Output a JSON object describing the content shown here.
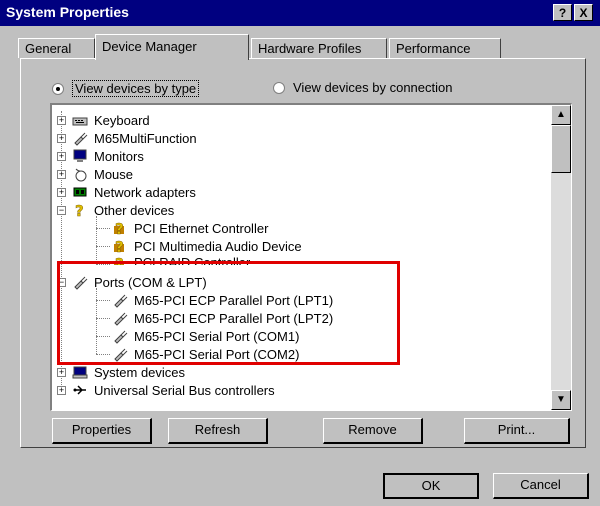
{
  "window": {
    "title": "System Properties",
    "help_label": "?",
    "close_label": "X"
  },
  "tabs": [
    {
      "label": "General"
    },
    {
      "label": "Device Manager"
    },
    {
      "label": "Hardware Profiles"
    },
    {
      "label": "Performance"
    }
  ],
  "view_options": {
    "by_type": "View devices by type",
    "by_connection": "View devices by connection",
    "selected": "by_type"
  },
  "tree": [
    {
      "label": "Keyboard",
      "icon": "keyboard-icon"
    },
    {
      "label": "M65MultiFunction",
      "icon": "plug-icon"
    },
    {
      "label": "Monitors",
      "icon": "monitor-icon"
    },
    {
      "label": "Mouse",
      "icon": "mouse-icon"
    },
    {
      "label": "Network adapters",
      "icon": "network-icon"
    },
    {
      "label": "Other devices",
      "icon": "question-icon"
    },
    {
      "label": "PCI Ethernet Controller",
      "icon": "question-icon"
    },
    {
      "label": "PCI Multimedia Audio Device",
      "icon": "question-icon"
    },
    {
      "label": "PCI RAID Controller",
      "icon": "question-icon"
    },
    {
      "label": "Ports (COM & LPT)",
      "icon": "plug-icon"
    },
    {
      "label": "M65-PCI ECP Parallel Port (LPT1)",
      "icon": "plug-icon"
    },
    {
      "label": "M65-PCI ECP Parallel Port (LPT2)",
      "icon": "plug-icon"
    },
    {
      "label": "M65-PCI Serial Port (COM1)",
      "icon": "plug-icon"
    },
    {
      "label": "M65-PCI Serial Port (COM2)",
      "icon": "plug-icon"
    },
    {
      "label": "System devices",
      "icon": "computer-icon"
    },
    {
      "label": "Universal Serial Bus controllers",
      "icon": "usb-icon"
    }
  ],
  "buttons": {
    "properties": "Properties",
    "refresh": "Refresh",
    "remove": "Remove",
    "print": "Print...",
    "ok": "OK",
    "cancel": "Cancel"
  },
  "colors": {
    "titlebar": "#000080",
    "highlight": "#e00000",
    "face": "#c0c0c0"
  }
}
